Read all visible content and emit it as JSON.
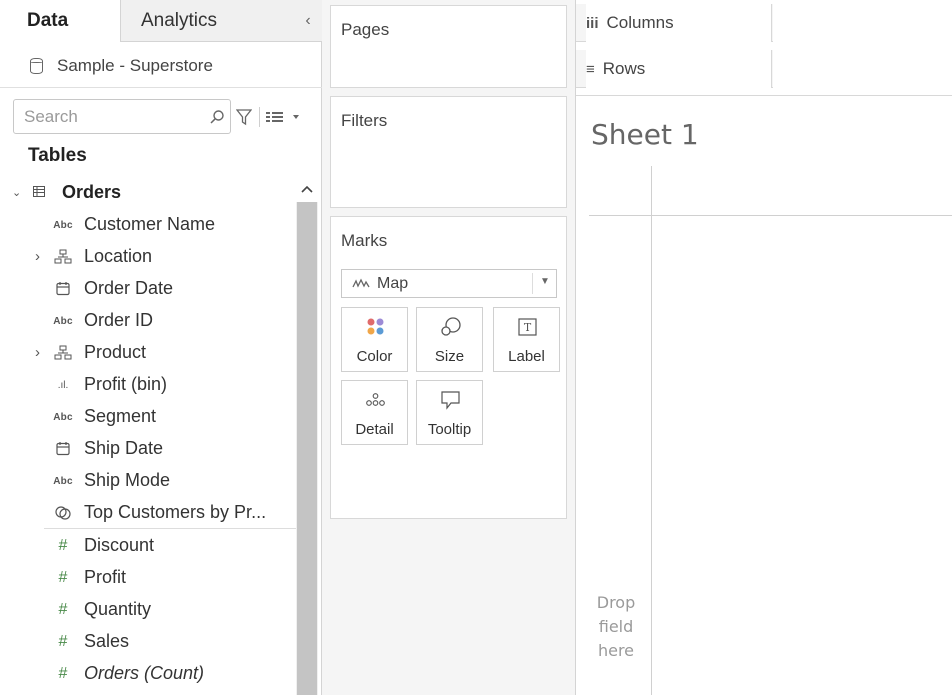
{
  "data_pane": {
    "tabs": [
      {
        "label": "Data",
        "active": true
      },
      {
        "label": "Analytics",
        "active": false
      }
    ],
    "collapse_glyph": "‹",
    "datasource": {
      "name": "Sample - Superstore",
      "icon": "database-icon"
    },
    "search": {
      "placeholder": "Search",
      "value": ""
    },
    "tables_title": "Tables",
    "table": {
      "name": "Orders",
      "expanded": true
    },
    "dimensions": [
      {
        "label": "Customer Name",
        "icon": "abc-icon",
        "glyph": "Abc",
        "expandable": false
      },
      {
        "label": "Location",
        "icon": "hierarchy-icon",
        "glyph": "",
        "expandable": true
      },
      {
        "label": "Order Date",
        "icon": "calendar-icon",
        "glyph": "",
        "expandable": false
      },
      {
        "label": "Order ID",
        "icon": "abc-icon",
        "glyph": "Abc",
        "expandable": false
      },
      {
        "label": "Product",
        "icon": "hierarchy-icon",
        "glyph": "",
        "expandable": true
      },
      {
        "label": "Profit (bin)",
        "icon": "bin-icon",
        "glyph": ".ıl.",
        "expandable": false
      },
      {
        "label": "Segment",
        "icon": "abc-icon",
        "glyph": "Abc",
        "expandable": false
      },
      {
        "label": "Ship Date",
        "icon": "calendar-icon",
        "glyph": "",
        "expandable": false
      },
      {
        "label": "Ship Mode",
        "icon": "abc-icon",
        "glyph": "Abc",
        "expandable": false
      },
      {
        "label": "Top Customers by Pr...",
        "icon": "set-icon",
        "glyph": "",
        "expandable": false
      }
    ],
    "measures": [
      {
        "label": "Discount",
        "icon": "hash-icon",
        "glyph": "#",
        "italic": false
      },
      {
        "label": "Profit",
        "icon": "hash-icon",
        "glyph": "#",
        "italic": false
      },
      {
        "label": "Quantity",
        "icon": "hash-icon",
        "glyph": "#",
        "italic": false
      },
      {
        "label": "Sales",
        "icon": "hash-icon",
        "glyph": "#",
        "italic": false
      },
      {
        "label": "Orders (Count)",
        "icon": "hash-icon",
        "glyph": "#",
        "italic": true
      }
    ]
  },
  "shelves": {
    "pages_title": "Pages",
    "filters_title": "Filters",
    "marks": {
      "title": "Marks",
      "mark_type": "Map",
      "buttons": [
        {
          "label": "Color",
          "icon": "color-icon"
        },
        {
          "label": "Size",
          "icon": "size-icon"
        },
        {
          "label": "Label",
          "icon": "label-icon"
        },
        {
          "label": "Detail",
          "icon": "detail-icon"
        },
        {
          "label": "Tooltip",
          "icon": "tooltip-icon"
        }
      ]
    }
  },
  "canvas": {
    "columns_label": "Columns",
    "columns_glyph": "iii",
    "rows_label": "Rows",
    "rows_glyph": "≡",
    "sheet_title": "Sheet 1",
    "drop_hint": [
      "Drop",
      "field",
      "here"
    ]
  },
  "colors": {
    "accent_green": "#4a8a4a",
    "pane_gray": "#f5f5f5",
    "border": "#d8d8d8",
    "scroll_thumb": "#c4c4c4"
  }
}
